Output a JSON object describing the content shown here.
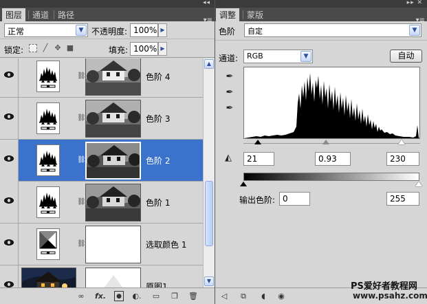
{
  "layers_panel": {
    "tabs": [
      "图层",
      "通道",
      "路径"
    ],
    "blend_mode": "正常",
    "opacity_label": "不透明度:",
    "opacity_value": "100%",
    "lock_label": "锁定:",
    "fill_label": "填充:",
    "fill_value": "100%",
    "layers": [
      {
        "name": "色阶 4",
        "type": "levels",
        "visible": true,
        "selected": false
      },
      {
        "name": "色阶 3",
        "type": "levels",
        "visible": true,
        "selected": false
      },
      {
        "name": "色阶 2",
        "type": "levels",
        "visible": true,
        "selected": true
      },
      {
        "name": "色阶 1",
        "type": "levels",
        "visible": true,
        "selected": false
      },
      {
        "name": "选取颜色 1",
        "type": "selective-color",
        "visible": true,
        "selected": false
      },
      {
        "name": "原图1",
        "type": "image",
        "visible": true,
        "selected": false
      }
    ],
    "footer_icons": [
      "link-icon",
      "fx-icon",
      "mask-icon",
      "adjustment-icon",
      "group-folder-icon",
      "new-layer-icon",
      "trash-icon"
    ]
  },
  "adjust_panel": {
    "tabs": [
      "调整",
      "蒙版"
    ],
    "title": "色阶",
    "preset_value": "自定",
    "channel_label": "通道:",
    "channel_value": "RGB",
    "auto_button": "自动",
    "input_black": "21",
    "input_gamma": "0.93",
    "input_white": "230",
    "input_slider_levels": {
      "black": 21,
      "gamma": 0.93,
      "white": 230
    },
    "output_label": "输出色阶:",
    "output_black": "0",
    "output_white": "255",
    "output_slider_levels": {
      "black": 0,
      "white": 255
    },
    "footer_icons": [
      "back-arrow-icon",
      "clip-to-layer-icon",
      "preview-toggle-icon",
      "view-previous-icon",
      "reset-icon",
      "visibility-eye-icon"
    ]
  },
  "watermark": {
    "line1": "PS爱好者教程网",
    "line2": "www.psahz.com"
  }
}
